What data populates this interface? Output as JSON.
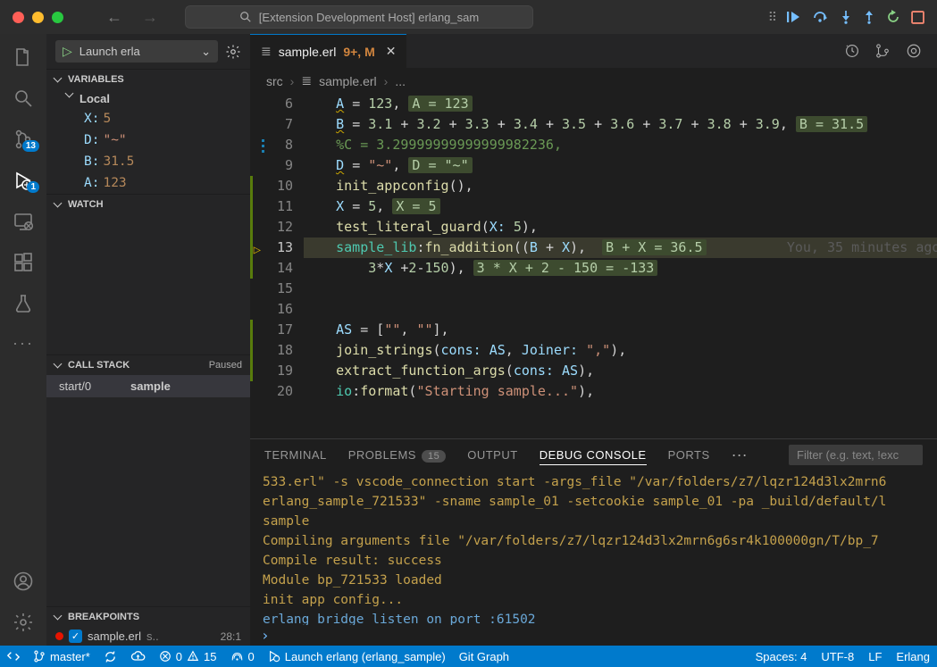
{
  "title": "[Extension Development Host] erlang_sam",
  "search_placeholder": "[Extension Development Host] erlang_sam",
  "launch_label": "Launch erla",
  "sections": {
    "variables": "Variables",
    "watch": "Watch",
    "callstack": "Call Stack",
    "callstack_status": "Paused",
    "breakpoints": "Breakpoints"
  },
  "var_scope": "Local",
  "vars": [
    {
      "k": "X:",
      "v": "5",
      "cls": ""
    },
    {
      "k": "D:",
      "v": "\"~\"",
      "cls": "str"
    },
    {
      "k": "B:",
      "v": "31.5",
      "cls": ""
    },
    {
      "k": "A:",
      "v": "123",
      "cls": ""
    }
  ],
  "callstack": {
    "fn": "start/0",
    "mod": "sample"
  },
  "breakpoint": {
    "file": "sample.erl",
    "path": "s..",
    "loc": "28:1"
  },
  "tab": {
    "icon": "≣",
    "name": "sample.erl",
    "mods": "9+, M"
  },
  "crumbs": {
    "a": "src",
    "b": "sample.erl",
    "c": "..."
  },
  "lines": [
    6,
    7,
    8,
    9,
    10,
    11,
    12,
    13,
    14,
    15,
    16,
    17,
    18,
    19,
    20
  ],
  "current_line": 13,
  "gutter_flags": {
    "8": "mod",
    "10": "add",
    "11": "add",
    "12": "add",
    "13": "bp",
    "14": "add",
    "17": "add",
    "18": "add",
    "19": "add"
  },
  "code": {
    "6": {
      "html": "    <span class='c-var squiggle'>A</span> <span class='c-op'>=</span> <span class='c-num'>123</span><span class='c-punc'>,</span> <span class='inline-hint'>A = 123</span>"
    },
    "7": {
      "html": "    <span class='c-var squiggle'>B</span> <span class='c-op'>=</span> <span class='c-num'>3.1</span> <span class='c-op'>+</span> <span class='c-num'>3.2</span> <span class='c-op'>+</span> <span class='c-num'>3.3</span> <span class='c-op'>+</span> <span class='c-num'>3.4</span> <span class='c-op'>+</span> <span class='c-num'>3.5</span> <span class='c-op'>+</span> <span class='c-num'>3.6</span> <span class='c-op'>+</span> <span class='c-num'>3.7</span> <span class='c-op'>+</span> <span class='c-num'>3.8</span> <span class='c-op'>+</span> <span class='c-num'>3.9</span><span class='c-punc'>,</span> <span class='inline-hint'>B = 31.5</span>"
    },
    "8": {
      "html": "    <span class='c-cmt'>%C = 3.29999999999999982236,</span>"
    },
    "9": {
      "html": "    <span class='c-var squiggle'>D</span> <span class='c-op'>=</span> <span class='c-str'>\"~\"</span><span class='c-punc'>,</span> <span class='inline-hint'>D = \"~\"</span>"
    },
    "10": {
      "html": "    <span class='c-fn'>init_appconfig</span><span class='c-punc'>(),</span>"
    },
    "11": {
      "html": "    <span class='c-var'>X</span> <span class='c-op'>=</span> <span class='c-num'>5</span><span class='c-punc'>,</span> <span class='inline-hint'>X = 5</span>"
    },
    "12": {
      "html": "    <span class='c-fn'>test_literal_guard</span><span class='c-punc'>(</span><span class='c-param'>X:</span> <span class='c-num'>5</span><span class='c-punc'>),</span>"
    },
    "13": {
      "html": "    <span class='c-mod'>sample_lib</span><span class='c-punc'>:</span><span class='c-fn'>fn_addition</span><span class='c-punc'>((</span><span class='c-var'>B</span> <span class='c-op'>+</span> <span class='c-var'>X</span><span class='c-punc'>),</span>  <span class='inline-hint'>B + X = 36.5</span>          <span class='blame'>You, 35 minutes ago</span>"
    },
    "14": {
      "html": "        <span class='c-num'>3</span><span class='c-op'>*</span><span class='c-var'>X</span> <span class='c-op'>+</span><span class='c-num'>2</span><span class='c-op'>-</span><span class='c-num'>150</span><span class='c-punc'>),</span> <span class='inline-hint'>3 * X + 2 - 150 = -133</span>"
    },
    "15": {
      "html": ""
    },
    "16": {
      "html": ""
    },
    "17": {
      "html": "    <span class='c-var'>AS</span> <span class='c-op'>=</span> <span class='c-punc'>[</span><span class='c-str'>\"\"</span><span class='c-punc'>,</span> <span class='c-str'>\"\"</span><span class='c-punc'>],</span>"
    },
    "18": {
      "html": "    <span class='c-fn'>join_strings</span><span class='c-punc'>(</span><span class='c-param'>cons:</span> <span class='c-var'>AS</span><span class='c-punc'>,</span> <span class='c-param'>Joiner:</span> <span class='c-str'>\",\"</span><span class='c-punc'>),</span>"
    },
    "19": {
      "html": "    <span class='c-fn'>extract_function_args</span><span class='c-punc'>(</span><span class='c-param'>cons:</span> <span class='c-var'>AS</span><span class='c-punc'>),</span>"
    },
    "20": {
      "html": "    <span class='c-mod'>io</span><span class='c-punc'>:</span><span class='c-fn'>format</span><span class='c-punc'>(</span><span class='c-str'>\"Starting sample...\"</span><span class='c-punc'>),</span>"
    }
  },
  "panel": {
    "tabs": {
      "terminal": "TERMINAL",
      "problems": "PROBLEMS",
      "output": "OUTPUT",
      "debug": "DEBUG CONSOLE",
      "ports": "PORTS"
    },
    "problem_count": "15",
    "filter_placeholder": "Filter (e.g. text, !exc"
  },
  "console": [
    {
      "cls": "out",
      "t": "533.erl\" -s vscode_connection start -args_file \"/var/folders/z7/lqzr124d3lx2mrn6"
    },
    {
      "cls": "out",
      "t": "erlang_sample_721533\" -sname sample_01 -setcookie sample_01 -pa _build/default/l"
    },
    {
      "cls": "out",
      "t": "sample"
    },
    {
      "cls": "out",
      "t": "Compiling arguments file  \"/var/folders/z7/lqzr124d3lx2mrn6g6sr4k100000gn/T/bp_7"
    },
    {
      "cls": "out",
      "t": "Compile result: success"
    },
    {
      "cls": "out",
      "t": "Module bp_721533 loaded"
    },
    {
      "cls": "out",
      "t": "init app config..."
    },
    {
      "cls": "info",
      "t": "erlang bridge listen on port :61502"
    }
  ],
  "status": {
    "remote": "⊗",
    "branch": "master*",
    "errors": "0",
    "warnings": "15",
    "signal": "0",
    "launch": "Launch erlang (erlang_sample)",
    "graph": "Git Graph",
    "spaces": "Spaces: 4",
    "encoding": "UTF-8",
    "eol": "LF",
    "lang": "Erlang"
  }
}
